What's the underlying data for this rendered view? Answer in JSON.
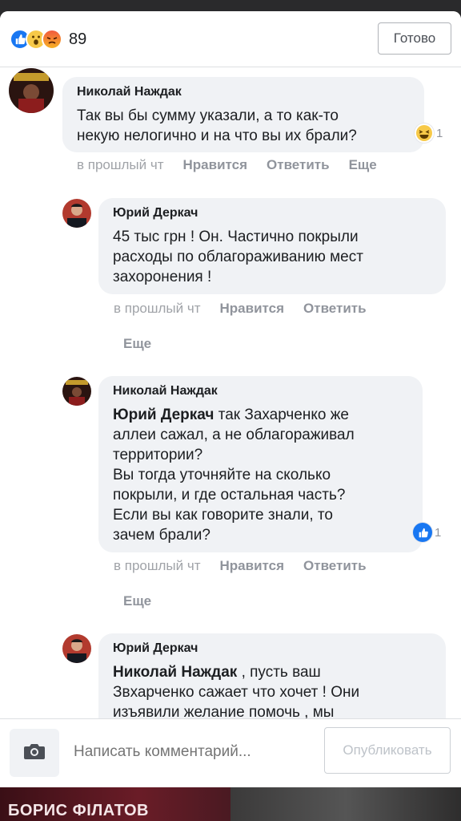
{
  "header": {
    "reaction_icons": [
      "like-icon",
      "wow-icon",
      "angry-icon"
    ],
    "reaction_count": "89",
    "done_label": "Готово"
  },
  "comments": [
    {
      "author": "Николай Наждак",
      "text": "Так вы бы сумму указали, а то как-то\nнекую нелогично и на что вы их брали?",
      "reaction_icon": "laugh-icon",
      "reaction_count": "1",
      "time": "в прошлый чт",
      "like_label": "Нравится",
      "reply_label": "Ответить",
      "more_label": "Еще"
    },
    {
      "author": "Юрий Деркач",
      "text": "45 тыс грн ! Он. Частично покрыли\nрасходы по облагораживанию мест\nзахоронения !",
      "time": "в прошлый чт",
      "like_label": "Нравится",
      "reply_label": "Ответить",
      "more_label": "Еще"
    },
    {
      "author": "Николай Наждак",
      "mention": "Юрий Деркач",
      "text": " так Захарченко же\nаллеи сажал, а не облагораживал\nтерритории?\nВы тогда уточняйте на сколько\nпокрыли, и где остальная часть?\nЕсли вы как говорите знали, то\nзачем брали?",
      "reaction_icon": "like-icon",
      "reaction_count": "1",
      "time": "в прошлый чт",
      "like_label": "Нравится",
      "reply_label": "Ответить",
      "more_label": "Еще"
    },
    {
      "author": "Юрий Деркач",
      "mention": "Николай Наждак",
      "text": " , пусть ваш\nЗвхарченко сажает что хочет ! Они\nизъявили желание помочь , мы"
    }
  ],
  "composer": {
    "camera_icon": "camera-icon",
    "placeholder": "Написать комментарий...",
    "publish_label": "Опубликовать"
  },
  "background": {
    "banner_text": "БОРИС ФІЛАТОВ"
  },
  "colors": {
    "accent": "#1877f2",
    "bubble": "#f0f2f5",
    "muted": "#90949c"
  }
}
